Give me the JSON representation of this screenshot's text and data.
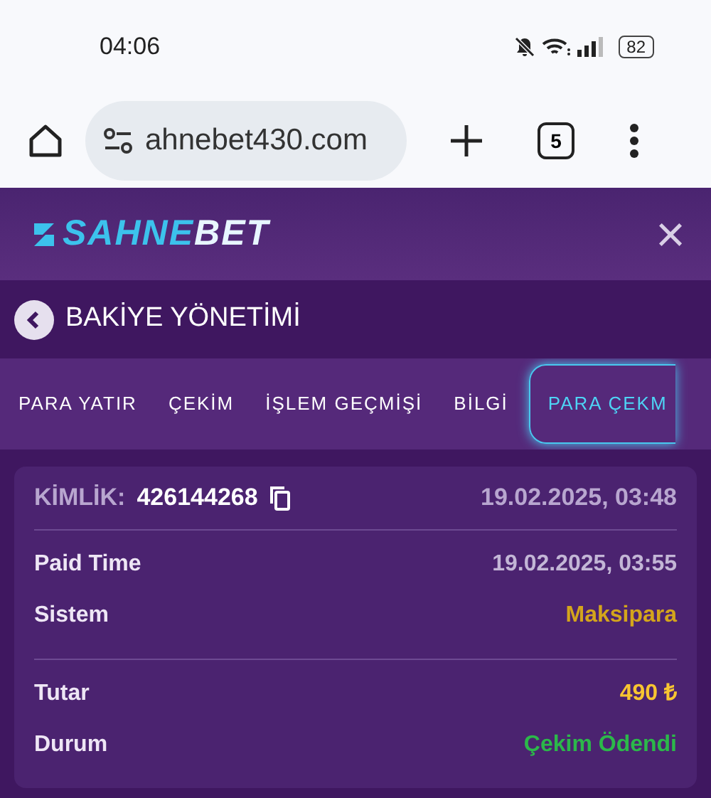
{
  "status_bar": {
    "time": "04:06",
    "battery": "82"
  },
  "browser": {
    "url": "ahnebet430.com",
    "tab_count": "5"
  },
  "header": {
    "logo_first": "SAHNE",
    "logo_second": "BET",
    "close": "×"
  },
  "title_bar": {
    "title": "BAKİYE YÖNETİMİ"
  },
  "tabs": [
    {
      "label": "PARA YATIR",
      "selected": false
    },
    {
      "label": "ÇEKİM",
      "selected": false
    },
    {
      "label": "İŞLEM GEÇMİŞİ",
      "selected": false
    },
    {
      "label": "BİLGİ",
      "selected": false
    },
    {
      "label": "PARA ÇEKM",
      "selected": true
    }
  ],
  "record": {
    "id_label": "KİMLİK:",
    "id": "426144268",
    "created": "19.02.2025, 03:48",
    "groups": [
      [
        {
          "label": "Paid Time",
          "value": "19.02.2025, 03:55",
          "color": "#c3b6d6"
        },
        {
          "label": "Sistem",
          "value": "Maksipara",
          "color": "#d4a51c"
        }
      ],
      [
        {
          "label": "Tutar",
          "value": "490 ₺",
          "color": "#f8c531"
        },
        {
          "label": "Durum",
          "value": "Çekim Ödendi",
          "color": "#2cb84a"
        }
      ]
    ]
  }
}
